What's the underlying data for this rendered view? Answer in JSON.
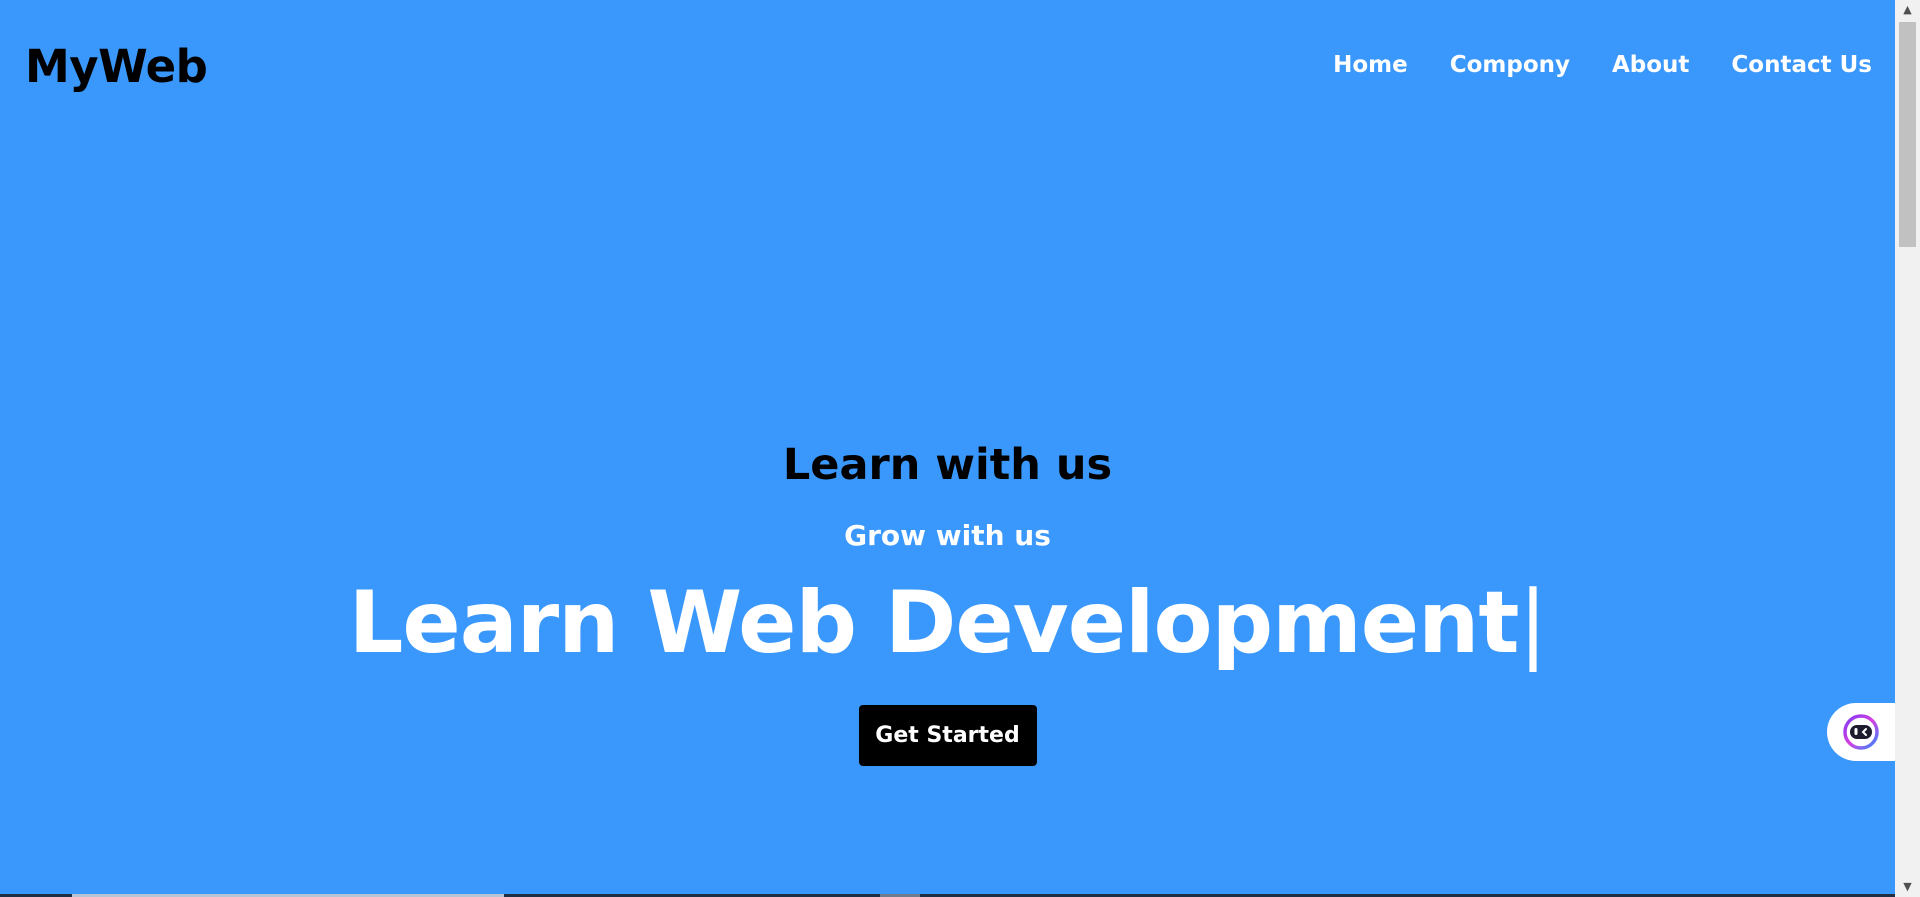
{
  "header": {
    "logo": "MyWeb",
    "nav": [
      "Home",
      "Compony",
      "About",
      "Contact Us"
    ]
  },
  "hero": {
    "tagline": "Learn with us",
    "subtagline": "Grow with us",
    "headline": "Learn Web Development",
    "cursor": "|",
    "cta_label": "Get Started"
  },
  "widget": {
    "icon": "chat-assistant-icon"
  },
  "colors": {
    "background": "#3a98fc",
    "cta_background": "#000000",
    "nav_text": "#ffffff"
  }
}
